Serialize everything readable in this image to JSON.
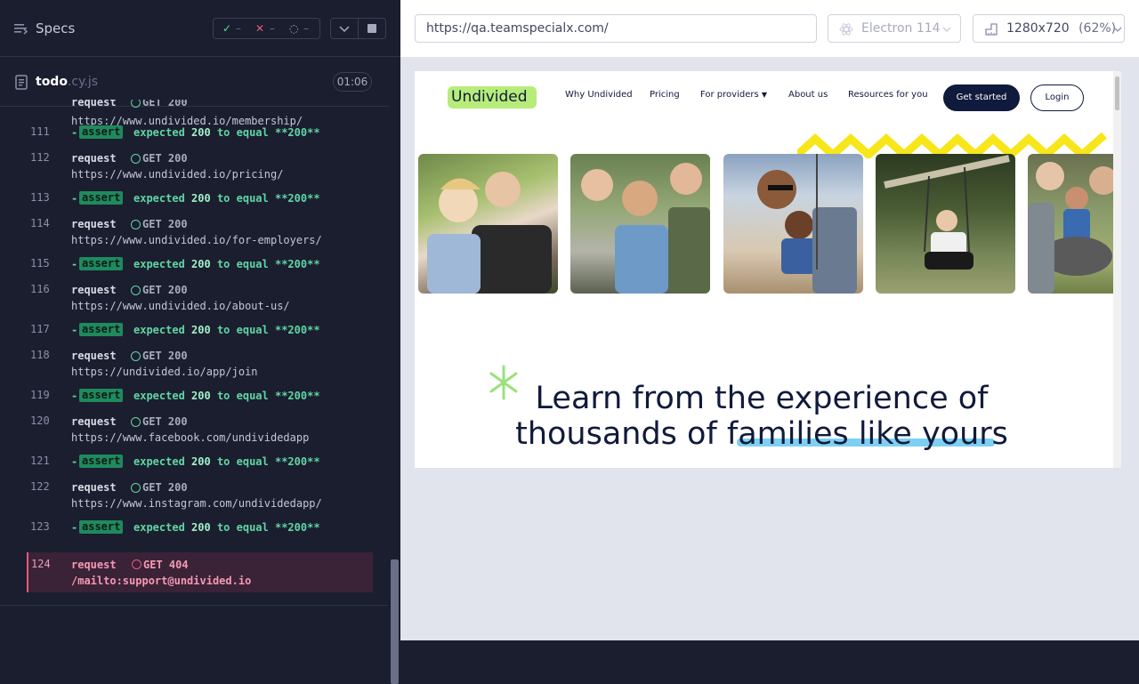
{
  "header": {
    "specs_label": "Specs",
    "stats": {
      "passed": "–",
      "failed": "–",
      "pending": "–"
    }
  },
  "file": {
    "name": "todo",
    "ext": ".cy.js",
    "duration": "01:06"
  },
  "log": {
    "partial_top": {
      "kw": "request",
      "method_text": "GET 200",
      "url": "https://www.undivided.io/membership/"
    },
    "rows": [
      {
        "num": "111",
        "type": "assert",
        "dash": "-",
        "badge": "assert",
        "text1": "expected",
        "val1": "200",
        "text2": "to equal",
        "val2": "**200**"
      },
      {
        "num": "112",
        "type": "request",
        "kw": "request",
        "method": "GET 200",
        "url": "https://www.undivided.io/pricing/"
      },
      {
        "num": "113",
        "type": "assert",
        "dash": "-",
        "badge": "assert",
        "text1": "expected",
        "val1": "200",
        "text2": "to equal",
        "val2": "**200**"
      },
      {
        "num": "114",
        "type": "request",
        "kw": "request",
        "method": "GET 200",
        "url": "https://www.undivided.io/for-employers/"
      },
      {
        "num": "115",
        "type": "assert",
        "dash": "-",
        "badge": "assert",
        "text1": "expected",
        "val1": "200",
        "text2": "to equal",
        "val2": "**200**"
      },
      {
        "num": "116",
        "type": "request",
        "kw": "request",
        "method": "GET 200",
        "url": "https://www.undivided.io/about-us/"
      },
      {
        "num": "117",
        "type": "assert",
        "dash": "-",
        "badge": "assert",
        "text1": "expected",
        "val1": "200",
        "text2": "to equal",
        "val2": "**200**"
      },
      {
        "num": "118",
        "type": "request",
        "kw": "request",
        "method": "GET 200",
        "url": "https://undivided.io/app/join"
      },
      {
        "num": "119",
        "type": "assert",
        "dash": "-",
        "badge": "assert",
        "text1": "expected",
        "val1": "200",
        "text2": "to equal",
        "val2": "**200**"
      },
      {
        "num": "120",
        "type": "request",
        "kw": "request",
        "method": "GET 200",
        "url": "https://www.facebook.com/undividedapp"
      },
      {
        "num": "121",
        "type": "assert",
        "dash": "-",
        "badge": "assert",
        "text1": "expected",
        "val1": "200",
        "text2": "to equal",
        "val2": "**200**"
      },
      {
        "num": "122",
        "type": "request",
        "kw": "request",
        "method": "GET 200",
        "url": "https://www.instagram.com/undividedapp/"
      },
      {
        "num": "123",
        "type": "assert",
        "dash": "-",
        "badge": "assert",
        "text1": "expected",
        "val1": "200",
        "text2": "to equal",
        "val2": "**200**"
      }
    ],
    "error_row": {
      "num": "124",
      "kw": "request",
      "method": "GET 404",
      "url": "/mailto:support@undivided.io"
    }
  },
  "browser": {
    "url": "https://qa.teamspecialx.com/",
    "engine": "Electron 114",
    "viewport": "1280x720",
    "zoom": "(62%)"
  },
  "site": {
    "logo": "Undivided",
    "nav": [
      "Why Undivided",
      "Pricing",
      "For providers",
      "About us",
      "Resources for you"
    ],
    "get_started": "Get started",
    "login": "Login",
    "headline_line1": "Learn from the experience of",
    "headline_line2_a": "thousands of ",
    "headline_line2_b": "families like yours"
  },
  "colors": {
    "sidebar_bg": "#1b1e2e",
    "pass_green": "#5fd6a4",
    "fail_red": "#e85a7a",
    "brand_navy": "#0f1a3c",
    "brand_lime": "#b7ec7a",
    "zigzag_yellow": "#f6e61a"
  }
}
